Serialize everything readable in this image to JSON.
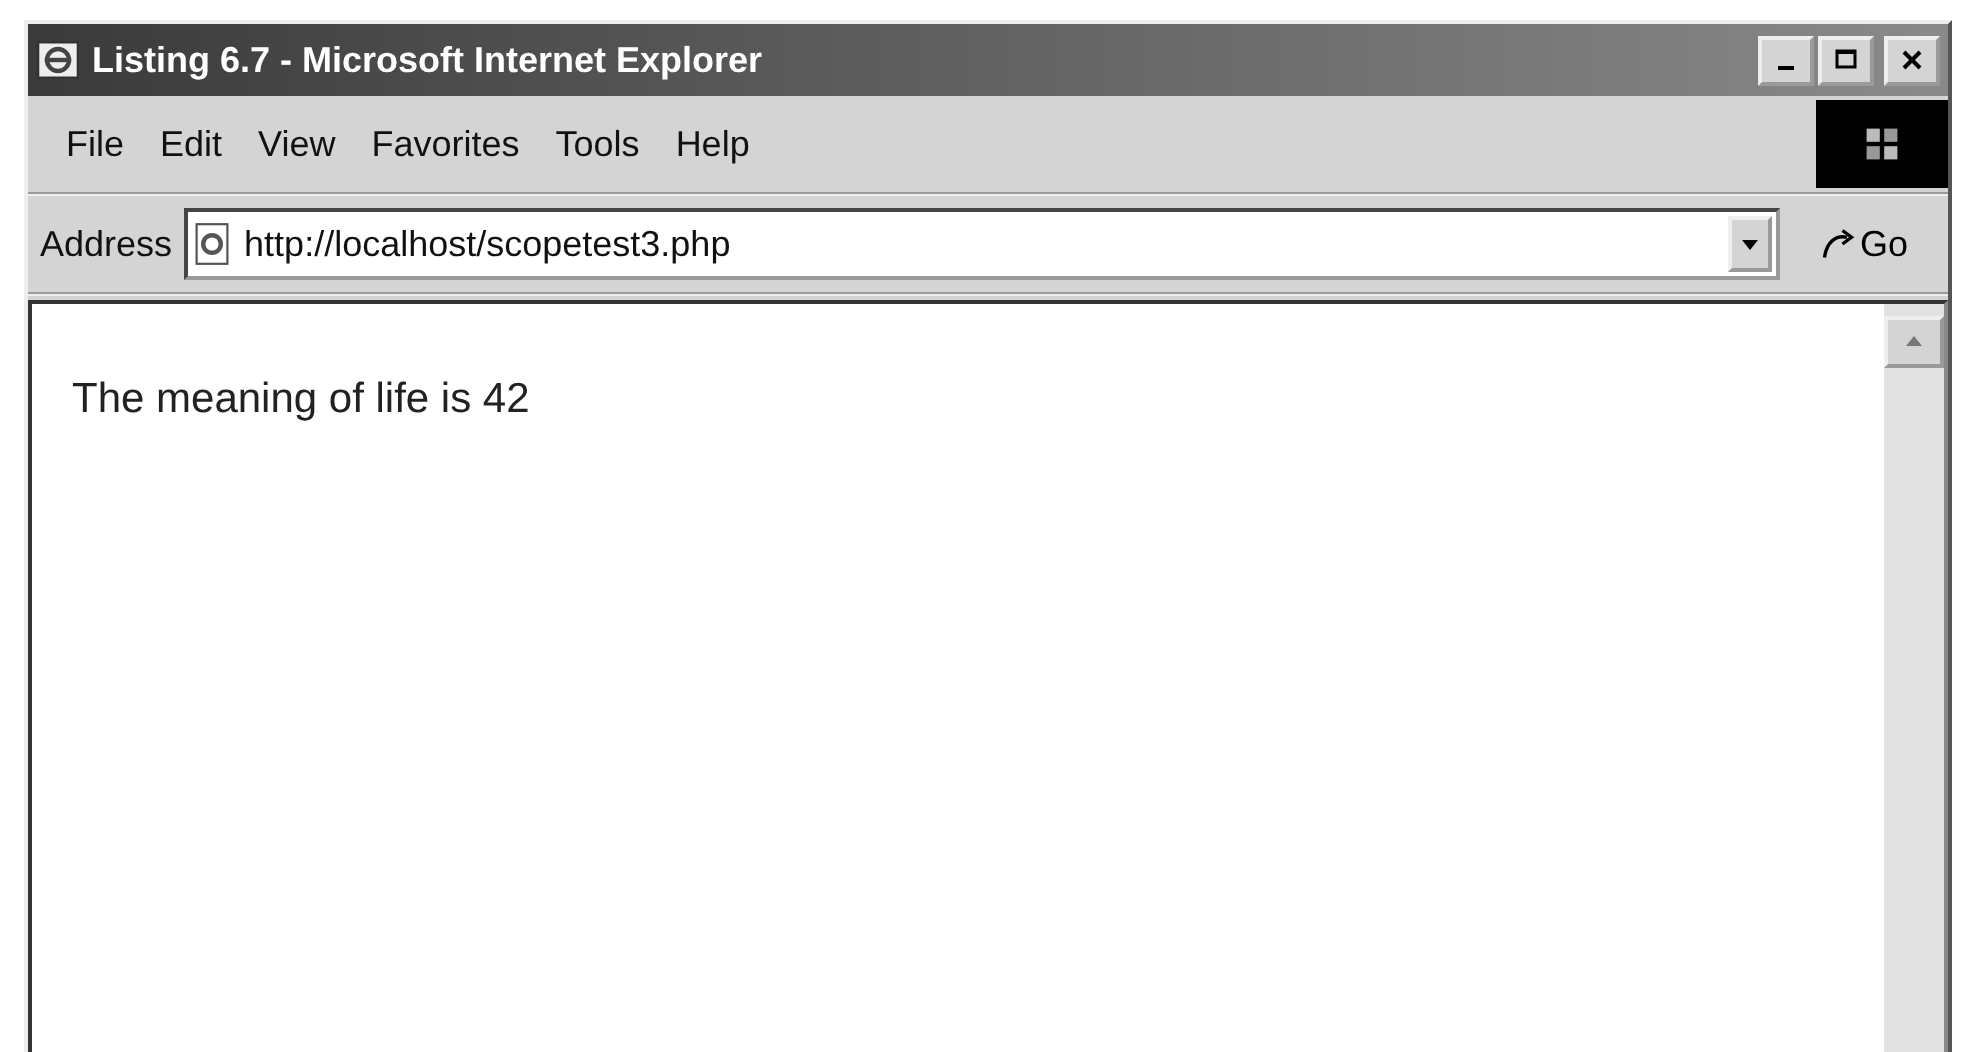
{
  "window": {
    "title": "Listing 6.7 - Microsoft Internet Explorer"
  },
  "menu": [
    "File",
    "Edit",
    "View",
    "Favorites",
    "Tools",
    "Help"
  ],
  "address_bar": {
    "label": "Address",
    "value": "http://localhost/scopetest3.php",
    "go_label": "Go"
  },
  "content": {
    "text": "The meaning of life is 42"
  }
}
